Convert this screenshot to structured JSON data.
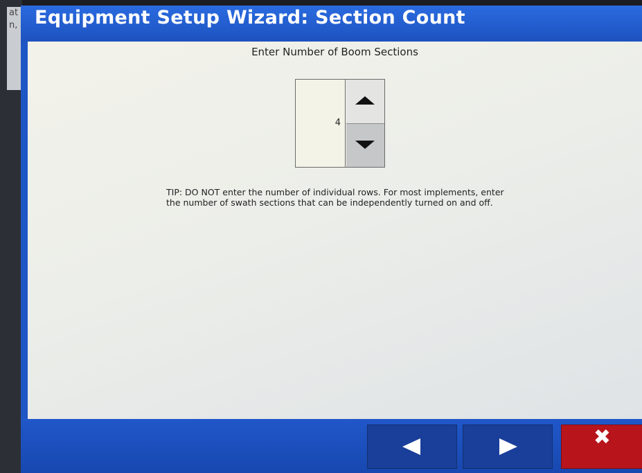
{
  "background_window": {
    "lines": [
      "at",
      "n,"
    ]
  },
  "wizard": {
    "title": "Equipment Setup Wizard:  Section Count",
    "prompt": "Enter Number of Boom Sections",
    "stepper": {
      "value": "4",
      "up_icon": "triangle-up",
      "down_icon": "triangle-down"
    },
    "tip": "TIP:  DO NOT enter the number of individual rows.  For most implements, enter the number of swath sections that can be independently turned on and off."
  },
  "footer": {
    "back_icon": "triangle-left",
    "next_icon": "triangle-right",
    "cancel_icon": "close-x",
    "cancel_glyph": "✖"
  },
  "colors": {
    "title_bar": "#1f56c5",
    "content_bg": "#eceee9",
    "nav_button": "#1a3f9a",
    "cancel_button": "#b8141c"
  }
}
